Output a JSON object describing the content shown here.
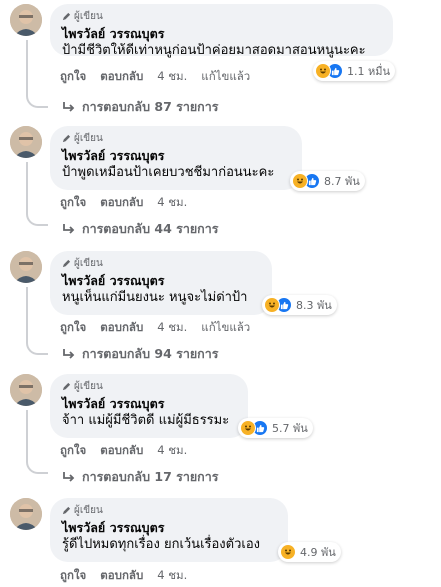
{
  "comments": [
    {
      "badge": "ผู้เขียน",
      "author": "ไพรวัลย์ วรรณบุตร",
      "text": "ป้ามีชีวิตให้ดีเท่าหนูก่อนป้าค่อยมาสอดมาสอนหนูนะคะ",
      "reaction_count": "1.1 หมื่น",
      "like_label": "ถูกใจ",
      "reply_label": "ตอบกลับ",
      "time": "4 ชม.",
      "edited": "แก้ไขแล้ว",
      "replies_text": "การตอบกลับ 87 รายการ"
    },
    {
      "badge": "ผู้เขียน",
      "author": "ไพรวัลย์ วรรณบุตร",
      "text": "ป้าพูดเหมือนป้าเคยบวชชีมาก่อนนะคะ",
      "reaction_count": "8.7 พัน",
      "like_label": "ถูกใจ",
      "reply_label": "ตอบกลับ",
      "time": "4 ชม.",
      "edited": "",
      "replies_text": "การตอบกลับ 44 รายการ"
    },
    {
      "badge": "ผู้เขียน",
      "author": "ไพรวัลย์ วรรณบุตร",
      "text": "หนูเห็นแก่มีนยงนะ หนูจะไม่ด่าป้า",
      "reaction_count": "8.3 พัน",
      "like_label": "ถูกใจ",
      "reply_label": "ตอบกลับ",
      "time": "4 ชม.",
      "edited": "แก้ไขแล้ว",
      "replies_text": "การตอบกลับ 94 รายการ"
    },
    {
      "badge": "ผู้เขียน",
      "author": "ไพรวัลย์ วรรณบุตร",
      "text": "จ้าา แม่ผู้มีชีวิตดี แม่ผู้มีธรรมะ",
      "reaction_count": "5.7 พัน",
      "like_label": "ถูกใจ",
      "reply_label": "ตอบกลับ",
      "time": "4 ชม.",
      "edited": "",
      "replies_text": "การตอบกลับ 17 รายการ"
    },
    {
      "badge": "ผู้เขียน",
      "author": "ไพรวัลย์ วรรณบุตร",
      "text": "รู้ดีไปหมดทุกเรื่อง ยกเว้นเรื่องตัวเอง",
      "reaction_count": "4.9 พัน",
      "like_label": "ถูกใจ",
      "reply_label": "ตอบกลับ",
      "time": "4 ชม.",
      "edited": "",
      "replies_text": ""
    }
  ],
  "colors": {
    "bubble": "#f0f2f5",
    "meta_text": "#65676b",
    "like_blue": "#1877f2",
    "haha_yellow": "#f7b125"
  }
}
